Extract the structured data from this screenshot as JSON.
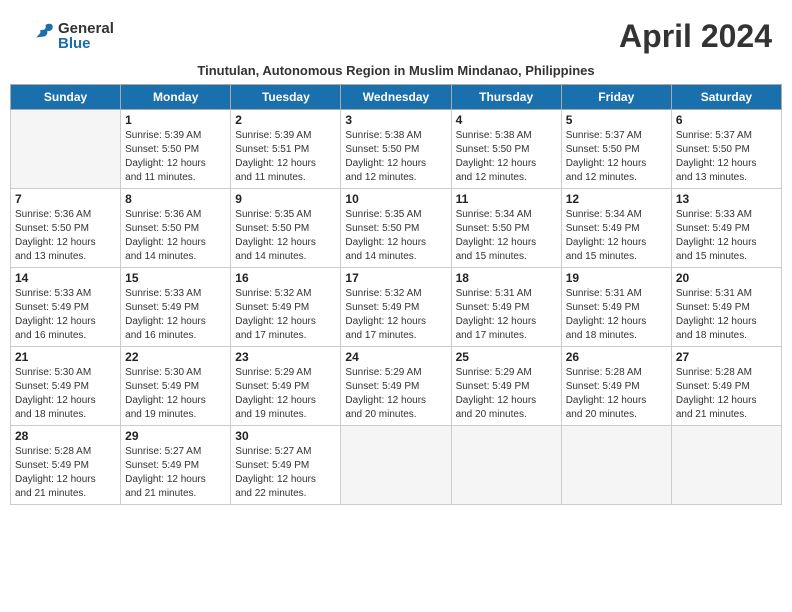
{
  "header": {
    "logo_general": "General",
    "logo_blue": "Blue",
    "month_title": "April 2024",
    "subtitle": "Tinutulan, Autonomous Region in Muslim Mindanao, Philippines"
  },
  "days_of_week": [
    "Sunday",
    "Monday",
    "Tuesday",
    "Wednesday",
    "Thursday",
    "Friday",
    "Saturday"
  ],
  "weeks": [
    [
      {
        "day": "",
        "info": ""
      },
      {
        "day": "1",
        "info": "Sunrise: 5:39 AM\nSunset: 5:50 PM\nDaylight: 12 hours\nand 11 minutes."
      },
      {
        "day": "2",
        "info": "Sunrise: 5:39 AM\nSunset: 5:51 PM\nDaylight: 12 hours\nand 11 minutes."
      },
      {
        "day": "3",
        "info": "Sunrise: 5:38 AM\nSunset: 5:50 PM\nDaylight: 12 hours\nand 12 minutes."
      },
      {
        "day": "4",
        "info": "Sunrise: 5:38 AM\nSunset: 5:50 PM\nDaylight: 12 hours\nand 12 minutes."
      },
      {
        "day": "5",
        "info": "Sunrise: 5:37 AM\nSunset: 5:50 PM\nDaylight: 12 hours\nand 12 minutes."
      },
      {
        "day": "6",
        "info": "Sunrise: 5:37 AM\nSunset: 5:50 PM\nDaylight: 12 hours\nand 13 minutes."
      }
    ],
    [
      {
        "day": "7",
        "info": "Sunrise: 5:36 AM\nSunset: 5:50 PM\nDaylight: 12 hours\nand 13 minutes."
      },
      {
        "day": "8",
        "info": "Sunrise: 5:36 AM\nSunset: 5:50 PM\nDaylight: 12 hours\nand 14 minutes."
      },
      {
        "day": "9",
        "info": "Sunrise: 5:35 AM\nSunset: 5:50 PM\nDaylight: 12 hours\nand 14 minutes."
      },
      {
        "day": "10",
        "info": "Sunrise: 5:35 AM\nSunset: 5:50 PM\nDaylight: 12 hours\nand 14 minutes."
      },
      {
        "day": "11",
        "info": "Sunrise: 5:34 AM\nSunset: 5:50 PM\nDaylight: 12 hours\nand 15 minutes."
      },
      {
        "day": "12",
        "info": "Sunrise: 5:34 AM\nSunset: 5:49 PM\nDaylight: 12 hours\nand 15 minutes."
      },
      {
        "day": "13",
        "info": "Sunrise: 5:33 AM\nSunset: 5:49 PM\nDaylight: 12 hours\nand 15 minutes."
      }
    ],
    [
      {
        "day": "14",
        "info": "Sunrise: 5:33 AM\nSunset: 5:49 PM\nDaylight: 12 hours\nand 16 minutes."
      },
      {
        "day": "15",
        "info": "Sunrise: 5:33 AM\nSunset: 5:49 PM\nDaylight: 12 hours\nand 16 minutes."
      },
      {
        "day": "16",
        "info": "Sunrise: 5:32 AM\nSunset: 5:49 PM\nDaylight: 12 hours\nand 17 minutes."
      },
      {
        "day": "17",
        "info": "Sunrise: 5:32 AM\nSunset: 5:49 PM\nDaylight: 12 hours\nand 17 minutes."
      },
      {
        "day": "18",
        "info": "Sunrise: 5:31 AM\nSunset: 5:49 PM\nDaylight: 12 hours\nand 17 minutes."
      },
      {
        "day": "19",
        "info": "Sunrise: 5:31 AM\nSunset: 5:49 PM\nDaylight: 12 hours\nand 18 minutes."
      },
      {
        "day": "20",
        "info": "Sunrise: 5:31 AM\nSunset: 5:49 PM\nDaylight: 12 hours\nand 18 minutes."
      }
    ],
    [
      {
        "day": "21",
        "info": "Sunrise: 5:30 AM\nSunset: 5:49 PM\nDaylight: 12 hours\nand 18 minutes."
      },
      {
        "day": "22",
        "info": "Sunrise: 5:30 AM\nSunset: 5:49 PM\nDaylight: 12 hours\nand 19 minutes."
      },
      {
        "day": "23",
        "info": "Sunrise: 5:29 AM\nSunset: 5:49 PM\nDaylight: 12 hours\nand 19 minutes."
      },
      {
        "day": "24",
        "info": "Sunrise: 5:29 AM\nSunset: 5:49 PM\nDaylight: 12 hours\nand 20 minutes."
      },
      {
        "day": "25",
        "info": "Sunrise: 5:29 AM\nSunset: 5:49 PM\nDaylight: 12 hours\nand 20 minutes."
      },
      {
        "day": "26",
        "info": "Sunrise: 5:28 AM\nSunset: 5:49 PM\nDaylight: 12 hours\nand 20 minutes."
      },
      {
        "day": "27",
        "info": "Sunrise: 5:28 AM\nSunset: 5:49 PM\nDaylight: 12 hours\nand 21 minutes."
      }
    ],
    [
      {
        "day": "28",
        "info": "Sunrise: 5:28 AM\nSunset: 5:49 PM\nDaylight: 12 hours\nand 21 minutes."
      },
      {
        "day": "29",
        "info": "Sunrise: 5:27 AM\nSunset: 5:49 PM\nDaylight: 12 hours\nand 21 minutes."
      },
      {
        "day": "30",
        "info": "Sunrise: 5:27 AM\nSunset: 5:49 PM\nDaylight: 12 hours\nand 22 minutes."
      },
      {
        "day": "",
        "info": ""
      },
      {
        "day": "",
        "info": ""
      },
      {
        "day": "",
        "info": ""
      },
      {
        "day": "",
        "info": ""
      }
    ]
  ]
}
